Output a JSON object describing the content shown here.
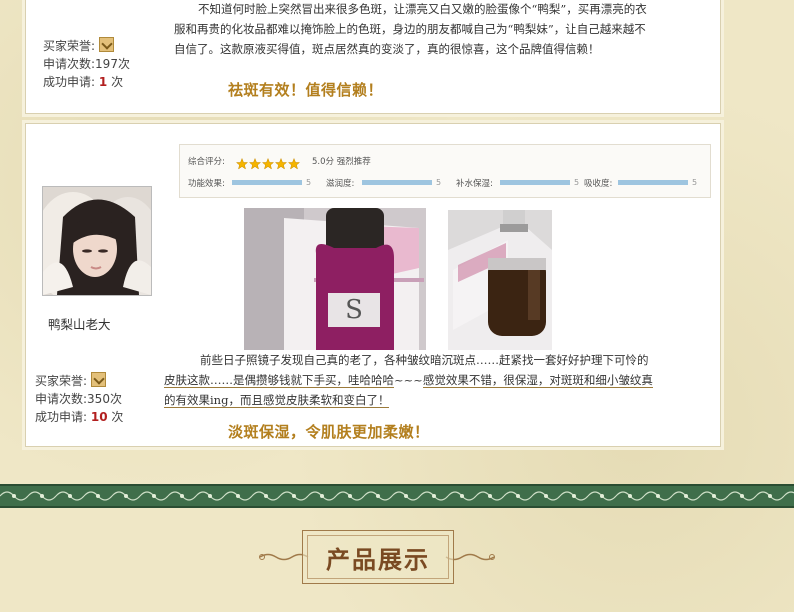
{
  "review1": {
    "text_line1": "不知道何时脸上突然冒出来很多色斑，让漂亮又白又嫩的脸蛋像个“鸭梨”，买再漂亮的衣",
    "text_line2": "服和再贵的化妆品都难以掩饰脸上的色斑，身边的朋友都喊自己为“鸭梨妹”，让自己越来越不",
    "text_line3": "自信了。这款原液买得值，斑点居然真的变淡了，真的很惊喜，这个品牌值得信赖！",
    "honor_label": "买家荣誉:",
    "apply_count_label": "申请次数:",
    "apply_count_value": "197次",
    "success_label": "成功申请:",
    "success_value": "1",
    "success_unit": "次",
    "headline": "祛斑有效！值得信赖！"
  },
  "review2": {
    "rating": {
      "overall_label": "综合评分:",
      "stars": 5,
      "overall_text": "5.0分 强烈推荐",
      "items": [
        {
          "label": "功能效果:",
          "value": "5",
          "fraction": 1.0
        },
        {
          "label": "滋润度:",
          "value": "5",
          "fraction": 1.0
        },
        {
          "label": "补水保湿:",
          "value": "5",
          "fraction": 1.0
        },
        {
          "label": "吸收度:",
          "value": "5",
          "fraction": 1.0
        }
      ]
    },
    "username": "鸭梨山老大",
    "text_line1": "前些日子照镜子发现自己真的老了，各种皱纹暗沉斑点……赶紧找一套好好护理下可怜的",
    "text_line2a": "皮肤这款……是偶攒够钱就下手买，哇哈哈哈",
    "text_line2_wave": "~~~",
    "text_line2b": "感觉效果不错，很保湿，对斑斑和细小皱纹真",
    "text_line3": "的有效果ing，而且感觉皮肤柔软和变白了！",
    "honor_label": "买家荣誉:",
    "apply_count_label": "申请次数:",
    "apply_count_value": "350次",
    "success_label": "成功申请:",
    "success_value": "10",
    "success_unit": "次",
    "headline": "淡斑保湿，令肌肤更加柔嫩！"
  },
  "section_title": "产品展示",
  "colors": {
    "accent_gold": "#b37f1e",
    "count_red": "#b21f1f",
    "band_green": "#3f6e4a",
    "title_brown": "#7a4a22"
  }
}
